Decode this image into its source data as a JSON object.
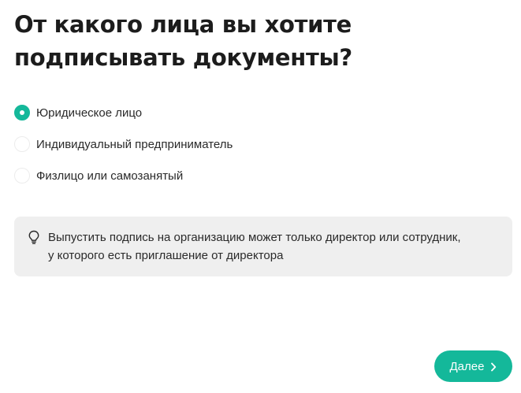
{
  "heading": "От какого лица вы хотите подписывать документы?",
  "options": [
    {
      "label": "Юридическое лицо",
      "selected": true
    },
    {
      "label": "Индивидуальный предприниматель",
      "selected": false
    },
    {
      "label": "Физлицо или самозанятый",
      "selected": false
    }
  ],
  "notice": {
    "icon": "lightbulb-icon",
    "line1": "Выпустить подпись на организацию может только директор или сотрудник,",
    "line2": "у которого есть приглашение от директора"
  },
  "next_button": {
    "label": "Далее",
    "icon": "chevron-right-icon"
  },
  "colors": {
    "accent": "#14b89a",
    "notice_background": "#efefef"
  }
}
